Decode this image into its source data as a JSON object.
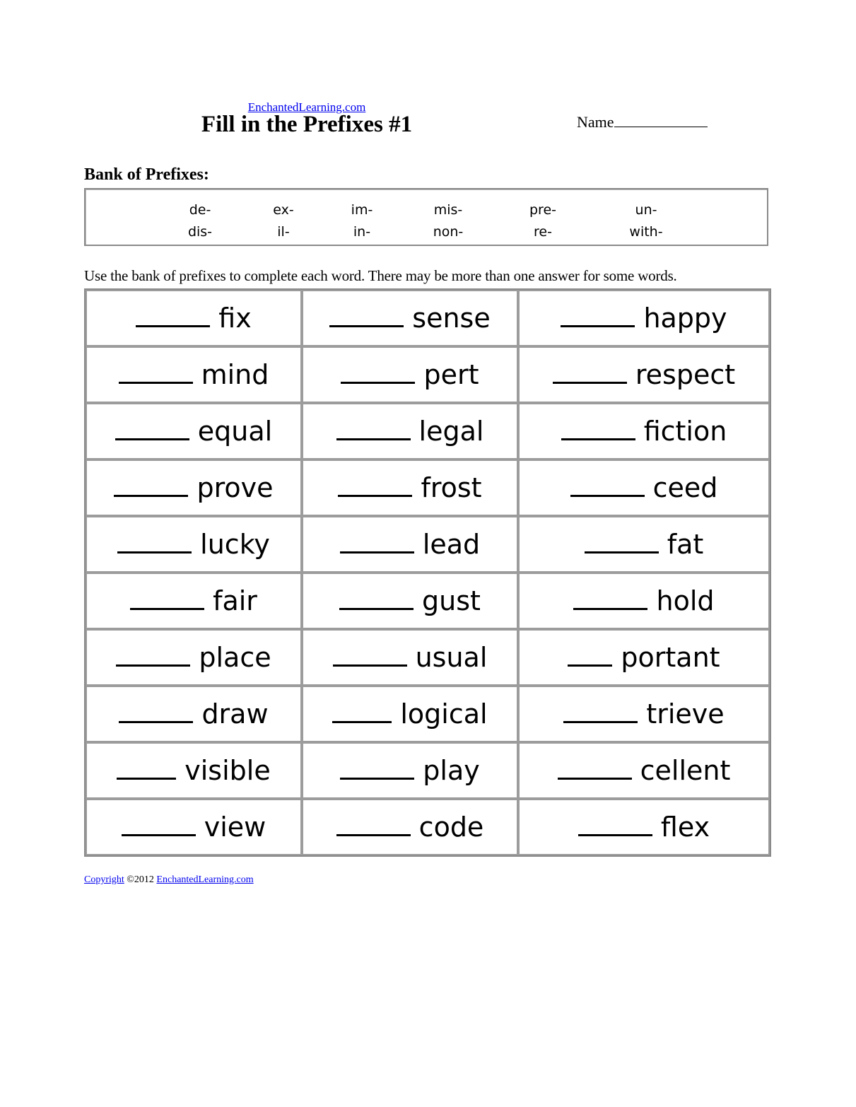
{
  "header": {
    "site_link": "EnchantedLearning.com",
    "title": "Fill in the Prefixes #1",
    "name_label": "Name"
  },
  "bank": {
    "heading": "Bank of Prefixes:",
    "columns": [
      [
        "de-",
        "dis-"
      ],
      [
        "ex-",
        "il-"
      ],
      [
        "im-",
        "in-"
      ],
      [
        "mis-",
        "non-"
      ],
      [
        "pre-",
        "re-"
      ],
      [
        "un-",
        "with-"
      ]
    ]
  },
  "instructions": "Use the bank of prefixes to complete each word. There may be more than one answer for some words.",
  "words": [
    [
      {
        "blank": 5,
        "word": "fix"
      },
      {
        "blank": 5,
        "word": "sense"
      },
      {
        "blank": 5,
        "word": "happy"
      }
    ],
    [
      {
        "blank": 5,
        "word": "mind"
      },
      {
        "blank": 5,
        "word": "pert"
      },
      {
        "blank": 5,
        "word": "respect"
      }
    ],
    [
      {
        "blank": 5,
        "word": "equal"
      },
      {
        "blank": 5,
        "word": "legal"
      },
      {
        "blank": 5,
        "word": "fiction"
      }
    ],
    [
      {
        "blank": 5,
        "word": "prove"
      },
      {
        "blank": 5,
        "word": "frost"
      },
      {
        "blank": 5,
        "word": "ceed"
      }
    ],
    [
      {
        "blank": 5,
        "word": "lucky"
      },
      {
        "blank": 5,
        "word": "lead"
      },
      {
        "blank": 5,
        "word": "fat"
      }
    ],
    [
      {
        "blank": 5,
        "word": "fair"
      },
      {
        "blank": 5,
        "word": "gust"
      },
      {
        "blank": 5,
        "word": "hold"
      }
    ],
    [
      {
        "blank": 5,
        "word": "place"
      },
      {
        "blank": 5,
        "word": "usual"
      },
      {
        "blank": 3,
        "word": "portant"
      }
    ],
    [
      {
        "blank": 5,
        "word": "draw"
      },
      {
        "blank": 4,
        "word": "logical"
      },
      {
        "blank": 5,
        "word": "trieve"
      }
    ],
    [
      {
        "blank": 4,
        "word": "visible"
      },
      {
        "blank": 5,
        "word": "play"
      },
      {
        "blank": 5,
        "word": "cellent"
      }
    ],
    [
      {
        "blank": 5,
        "word": "view"
      },
      {
        "blank": 5,
        "word": "code"
      },
      {
        "blank": 5,
        "word": "flex"
      }
    ]
  ],
  "footer": {
    "copyright_link": "Copyright",
    "year_text": "©2012",
    "site_link": "EnchantedLearning.com"
  },
  "colors": {
    "link": "#0000ee",
    "border": "#8a8a8a"
  }
}
